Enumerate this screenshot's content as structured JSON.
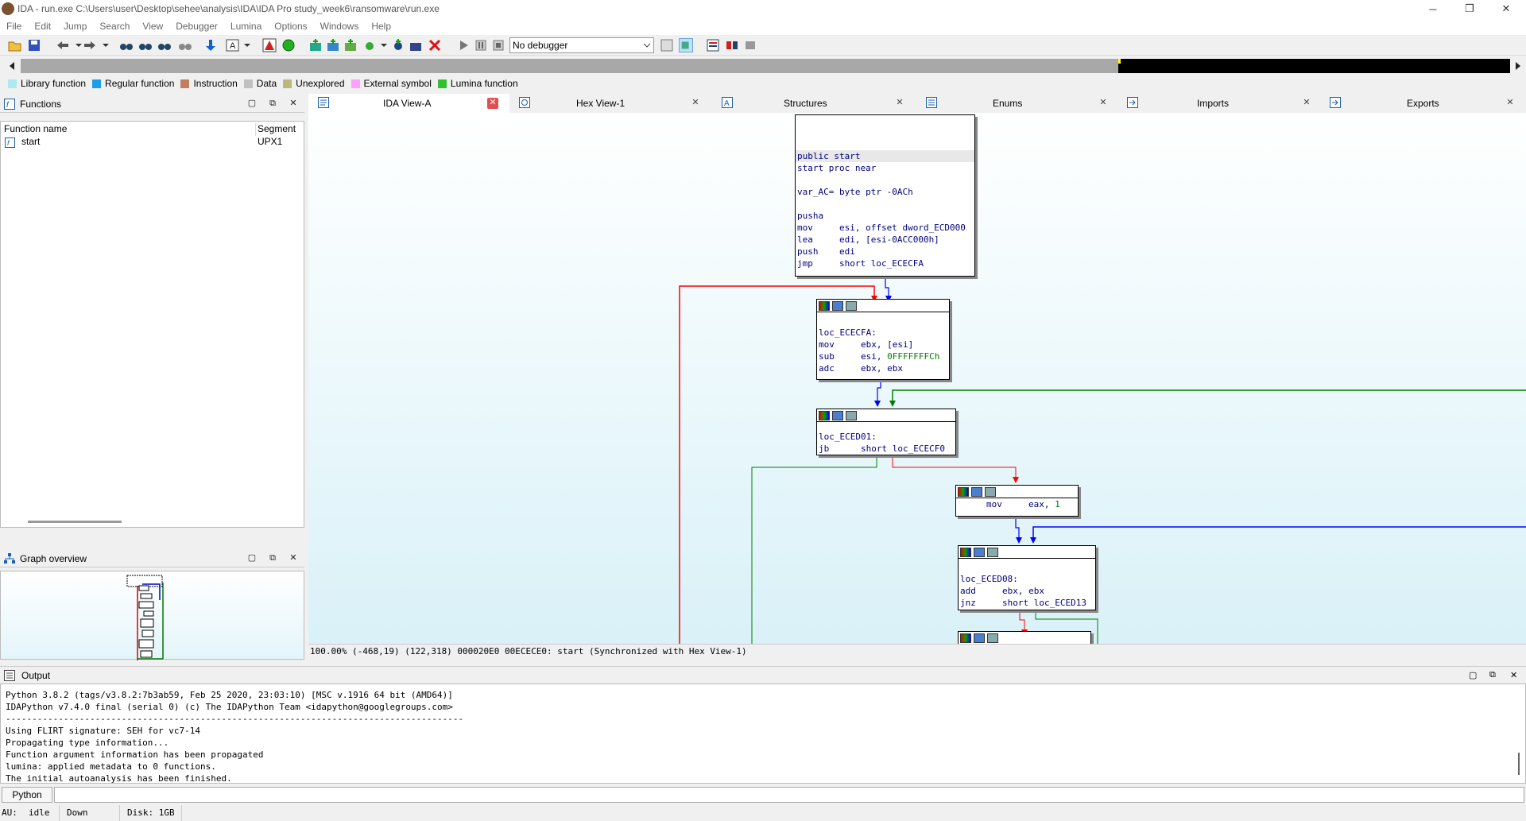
{
  "window": {
    "title": "IDA - run.exe C:\\Users\\user\\Desktop\\sehee\\analysis\\IDA\\IDA Pro study_week6\\ransomware\\run.exe",
    "minimize": "─",
    "restore": "❐",
    "close": "✕"
  },
  "menu": [
    "File",
    "Edit",
    "Jump",
    "Search",
    "View",
    "Debugger",
    "Lumina",
    "Options",
    "Windows",
    "Help"
  ],
  "toolbar": {
    "debugger_select": "No debugger"
  },
  "legend": [
    {
      "label": "Library function",
      "color": "#aee8f0"
    },
    {
      "label": "Regular function",
      "color": "#1b9ee8"
    },
    {
      "label": "Instruction",
      "color": "#c08060"
    },
    {
      "label": "Data",
      "color": "#c0c0c0"
    },
    {
      "label": "Unexplored",
      "color": "#b8b880"
    },
    {
      "label": "External symbol",
      "color": "#ffa0ff"
    },
    {
      "label": "Lumina function",
      "color": "#30c030"
    }
  ],
  "functions_panel": {
    "title": "Functions",
    "col_name": "Function name",
    "col_segment": "Segment",
    "rows": [
      {
        "name": "start",
        "segment": "UPX1"
      }
    ]
  },
  "graph_overview": {
    "title": "Graph overview"
  },
  "tabs": [
    {
      "label": "IDA View-A",
      "active": true
    },
    {
      "label": "Hex View-1"
    },
    {
      "label": "Structures"
    },
    {
      "label": "Enums"
    },
    {
      "label": "Imports"
    },
    {
      "label": "Exports"
    }
  ],
  "nodes": {
    "n1": [
      "public start",
      "start proc near",
      "",
      "var_AC= byte ptr -0ACh",
      "",
      "pusha",
      "mov     esi, offset dword_ECD000",
      "lea     edi, [esi-0ACC000h]",
      "push    edi",
      "jmp     short loc_ECECFA"
    ],
    "n2": [
      "loc_ECECFA:",
      "mov     ebx, [esi]",
      "sub     esi, ",
      "adc     ebx, ebx"
    ],
    "n2_const": "0FFFFFFFCh",
    "n3": [
      "loc_ECED01:",
      "jb      short loc_ECECF0"
    ],
    "n4_prefix": "mov     eax, ",
    "n4_const": "1",
    "n5": [
      "loc_ECED08:",
      "add     ebx, ebx",
      "jnz     short loc_ECED13"
    ]
  },
  "graph_status": "100.00% (-468,19) (122,318) 000020E0 00ECECE0: start (Synchronized with Hex View-1)",
  "output": {
    "title": "Output",
    "lines": [
      "Python 3.8.2 (tags/v3.8.2:7b3ab59, Feb 25 2020, 23:03:10) [MSC v.1916 64 bit (AMD64)]",
      "IDAPython v7.4.0 final (serial 0) (c) The IDAPython Team <idapython@googlegroups.com>",
      "---------------------------------------------------------------------------------------",
      "Using FLIRT signature: SEH for vc7-14",
      "Propagating type information...",
      "Function argument information has been propagated",
      "lumina: applied metadata to 0 functions.",
      "The initial autoanalysis has been finished."
    ]
  },
  "cmdline": {
    "lang": "Python"
  },
  "statusbar": {
    "au": "AU:",
    "state": "idle",
    "dir": "Down",
    "disk": "Disk: 1GB"
  }
}
